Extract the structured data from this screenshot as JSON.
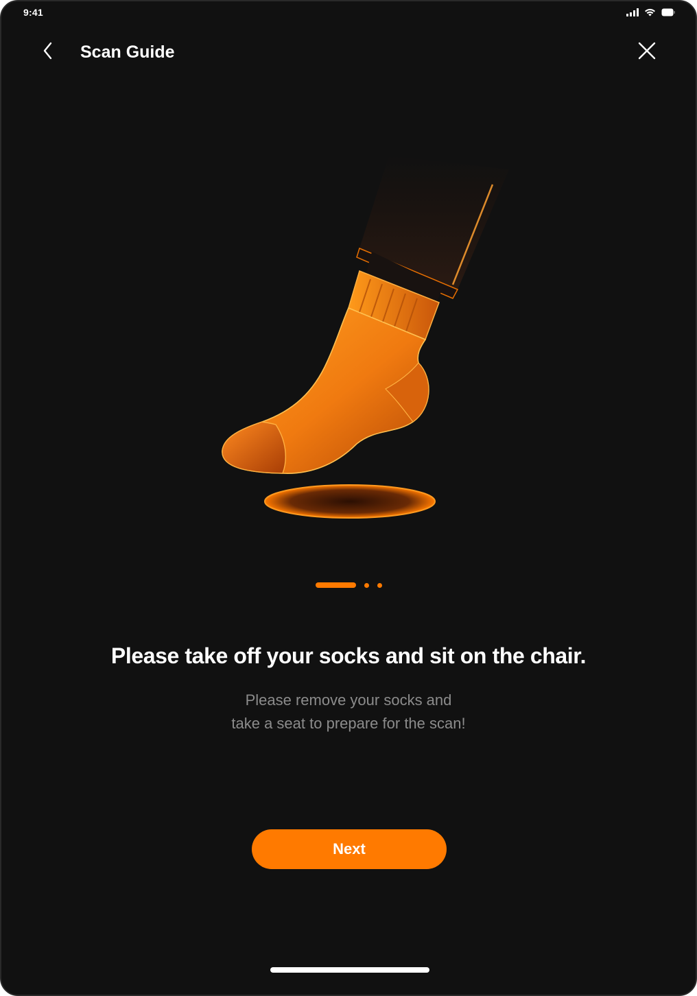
{
  "status_bar": {
    "time": "9:41",
    "icons": [
      "cellular-signal-icon",
      "wifi-icon",
      "battery-icon"
    ]
  },
  "nav": {
    "back_icon": "chevron-left-icon",
    "title": "Scan Guide",
    "close_icon": "close-icon"
  },
  "illustration": {
    "subject": "sock-foot-illustration"
  },
  "pager": {
    "current_page": 1,
    "total_pages": 3
  },
  "content": {
    "headline": "Please take off your socks and sit on the chair.",
    "subtext_line1": "Please remove your socks and",
    "subtext_line2": "take a seat to prepare for the scan!"
  },
  "actions": {
    "next_label": "Next"
  },
  "colors": {
    "background": "#111111",
    "accent": "#ff7a00",
    "primary_text": "#ffffff",
    "secondary_text": "#8c8c8c"
  }
}
